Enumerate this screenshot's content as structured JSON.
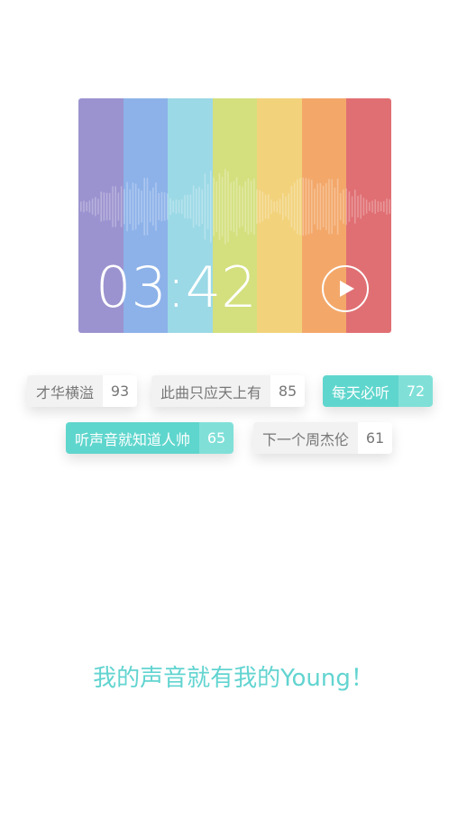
{
  "player": {
    "time": "03:42",
    "stripe_colors": [
      "#9b93cf",
      "#8db2e9",
      "#9bd9e6",
      "#d4e07e",
      "#f2d27b",
      "#f3a86a",
      "#e06f73"
    ]
  },
  "tags": [
    {
      "label": "才华横溢",
      "count": "93",
      "style": "gray"
    },
    {
      "label": "此曲只应天上有",
      "count": "85",
      "style": "gray"
    },
    {
      "label": "每天必听",
      "count": "72",
      "style": "teal"
    },
    {
      "label": "听声音就知道人帅",
      "count": "65",
      "style": "teal"
    },
    {
      "label": "下一个周杰伦",
      "count": "61",
      "style": "gray"
    }
  ],
  "slogan": "我的声音就有我的Young！"
}
